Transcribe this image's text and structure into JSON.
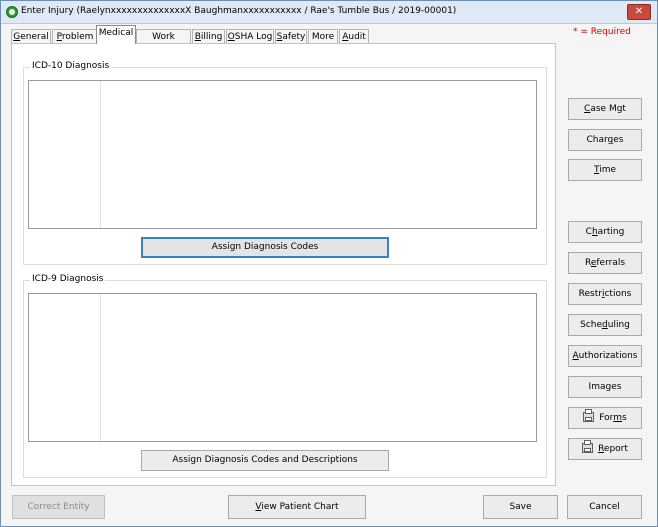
{
  "window": {
    "title": "Enter Injury (RaelynxxxxxxxxxxxxxxX Baughmanxxxxxxxxxxx / Rae's Tumble Bus / 2019-00001)",
    "close_glyph": "✕"
  },
  "required_note": "* = Required",
  "tabs": [
    {
      "label": "General",
      "underline": "G",
      "rest": "eneral"
    },
    {
      "label": "Problem",
      "underline": "P",
      "rest": "roblem"
    },
    {
      "label": "Medical",
      "underline": "",
      "rest": "Medical"
    },
    {
      "label": "Work Status",
      "underline": "",
      "rest": "Work Status"
    },
    {
      "label": "Billing",
      "underline": "B",
      "rest": "illing"
    },
    {
      "label": "OSHA Log",
      "underline": "O",
      "rest": "SHA Log"
    },
    {
      "label": "Safety",
      "underline": "S",
      "rest": "afety"
    },
    {
      "label": "More",
      "underline": "",
      "rest": "More"
    },
    {
      "label": "Audit",
      "underline": "A",
      "rest": "udit"
    }
  ],
  "icd10": {
    "label": "ICD-10 Diagnosis",
    "assign_button": "Assign Diagnosis Codes"
  },
  "icd9": {
    "label": "ICD-9 Diagnosis",
    "assign_button": "Assign Diagnosis Codes and Descriptions"
  },
  "side_buttons": {
    "case_mgt": {
      "pre": "",
      "u": "C",
      "post": "ase Mgt"
    },
    "charges": {
      "pre": "Char",
      "u": "g",
      "post": "es"
    },
    "time": {
      "pre": "",
      "u": "T",
      "post": "ime"
    },
    "charting": {
      "pre": "C",
      "u": "h",
      "post": "arting"
    },
    "referrals": {
      "pre": "R",
      "u": "e",
      "post": "ferrals"
    },
    "restrictions": {
      "pre": "Restr",
      "u": "i",
      "post": "ctions"
    },
    "scheduling": {
      "pre": "Sche",
      "u": "d",
      "post": "uling"
    },
    "authorizations": {
      "pre": "",
      "u": "A",
      "post": "uthorizations"
    },
    "images": {
      "pre": "Images",
      "u": "",
      "post": ""
    },
    "forms": {
      "pre": "For",
      "u": "m",
      "post": "s"
    },
    "report": {
      "pre": "",
      "u": "R",
      "post": "eport"
    }
  },
  "bottom": {
    "correct_entity": "Correct Entity",
    "view_chart": {
      "pre": "",
      "u": "V",
      "post": "iew Patient Chart"
    },
    "save": "Save",
    "cancel": "Cancel"
  },
  "icons": [
    "close-icon",
    "app-icon",
    "printer-icon"
  ],
  "colors": {
    "required": "#d60000",
    "focus_border": "#3e7ec4",
    "title_bar": "#dfe9f5"
  }
}
